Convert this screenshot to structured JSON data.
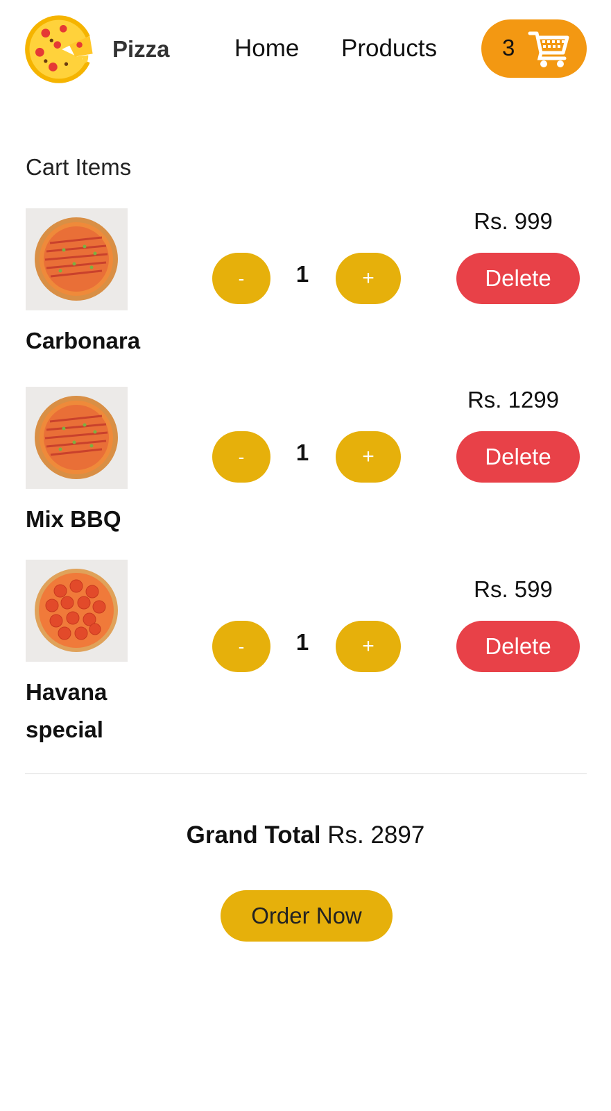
{
  "header": {
    "logo_icon": "pizza-slice-icon",
    "brand": "Pizza",
    "nav": {
      "home": "Home",
      "products": "Products"
    },
    "cart": {
      "count": "3",
      "icon": "shopping-cart-icon",
      "color": "#f39812"
    }
  },
  "cart_title": "Cart Items",
  "items": [
    {
      "name": "Carbonara",
      "quantity": "1",
      "price": "Rs. 999",
      "decrement": "-",
      "increment": "+",
      "delete": "Delete",
      "image_icon": "pizza-image"
    },
    {
      "name": "Mix BBQ",
      "quantity": "1",
      "price": "Rs. 1299",
      "decrement": "-",
      "increment": "+",
      "delete": "Delete",
      "image_icon": "pizza-image"
    },
    {
      "name": "Havana special",
      "quantity": "1",
      "price": "Rs. 599",
      "decrement": "-",
      "increment": "+",
      "delete": "Delete",
      "image_icon": "pepperoni-pizza-image"
    }
  ],
  "grand_total": {
    "label": "Grand Total",
    "value": "Rs. 2897"
  },
  "order_button": "Order Now",
  "colors": {
    "accent": "#e6b00b",
    "delete": "#e84148",
    "cart": "#f39812"
  }
}
